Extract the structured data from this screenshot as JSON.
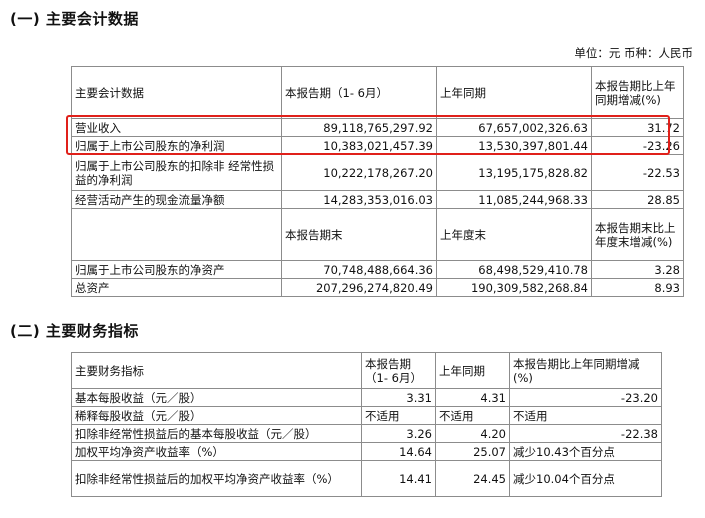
{
  "section1": {
    "title": "(一) 主要会计数据",
    "unit_line": "单位：元 币种：人民币",
    "header1": [
      "主要会计数据",
      "本报告期（1- 6月）",
      "上年同期",
      "本报告期比上年同期增减(%)"
    ],
    "rows1": [
      [
        "营业收入",
        "89,118,765,297.92",
        "67,657,002,326.63",
        "31.72"
      ],
      [
        "归属于上市公司股东的净利润",
        "10,383,021,457.39",
        "13,530,397,801.44",
        "-23.26"
      ],
      [
        "归属于上市公司股东的扣除非 经常性损益的净利润",
        "10,222,178,267.20",
        "13,195,175,828.82",
        "-22.53"
      ],
      [
        "经营活动产生的现金流量净额",
        "14,283,353,016.03",
        "11,085,244,968.33",
        "28.85"
      ]
    ],
    "header2": [
      "",
      "本报告期末",
      "上年度末",
      "本报告期末比上年度末增减(%)"
    ],
    "rows2": [
      [
        "归属于上市公司股东的净资产",
        "70,748,488,664.36",
        "68,498,529,410.78",
        "3.28"
      ],
      [
        "总资产",
        "207,296,274,820.49",
        "190,309,582,268.84",
        "8.93"
      ]
    ]
  },
  "section2": {
    "title": "(二) 主要财务指标",
    "header": [
      "主要财务指标",
      "本报告期（1- 6月）",
      "上年同期",
      "本报告期比上年同期增减(%)"
    ],
    "rows": [
      [
        "基本每股收益（元／股）",
        "3.31",
        "4.31",
        "-23.20"
      ],
      [
        "稀释每股收益（元／股）",
        "不适用",
        "不适用",
        "不适用"
      ],
      [
        "扣除非经常性损益后的基本每股收益（元／股）",
        "3.26",
        "4.20",
        "-22.38"
      ],
      [
        "加权平均净资产收益率（%）",
        "14.64",
        "25.07",
        "减少10.43个百分点"
      ],
      [
        "扣除非经常性损益后的加权平均净资产收益率（%）",
        "14.41",
        "24.45",
        "减少10.04个百分点"
      ]
    ]
  },
  "highlight_color": "#e0201a"
}
